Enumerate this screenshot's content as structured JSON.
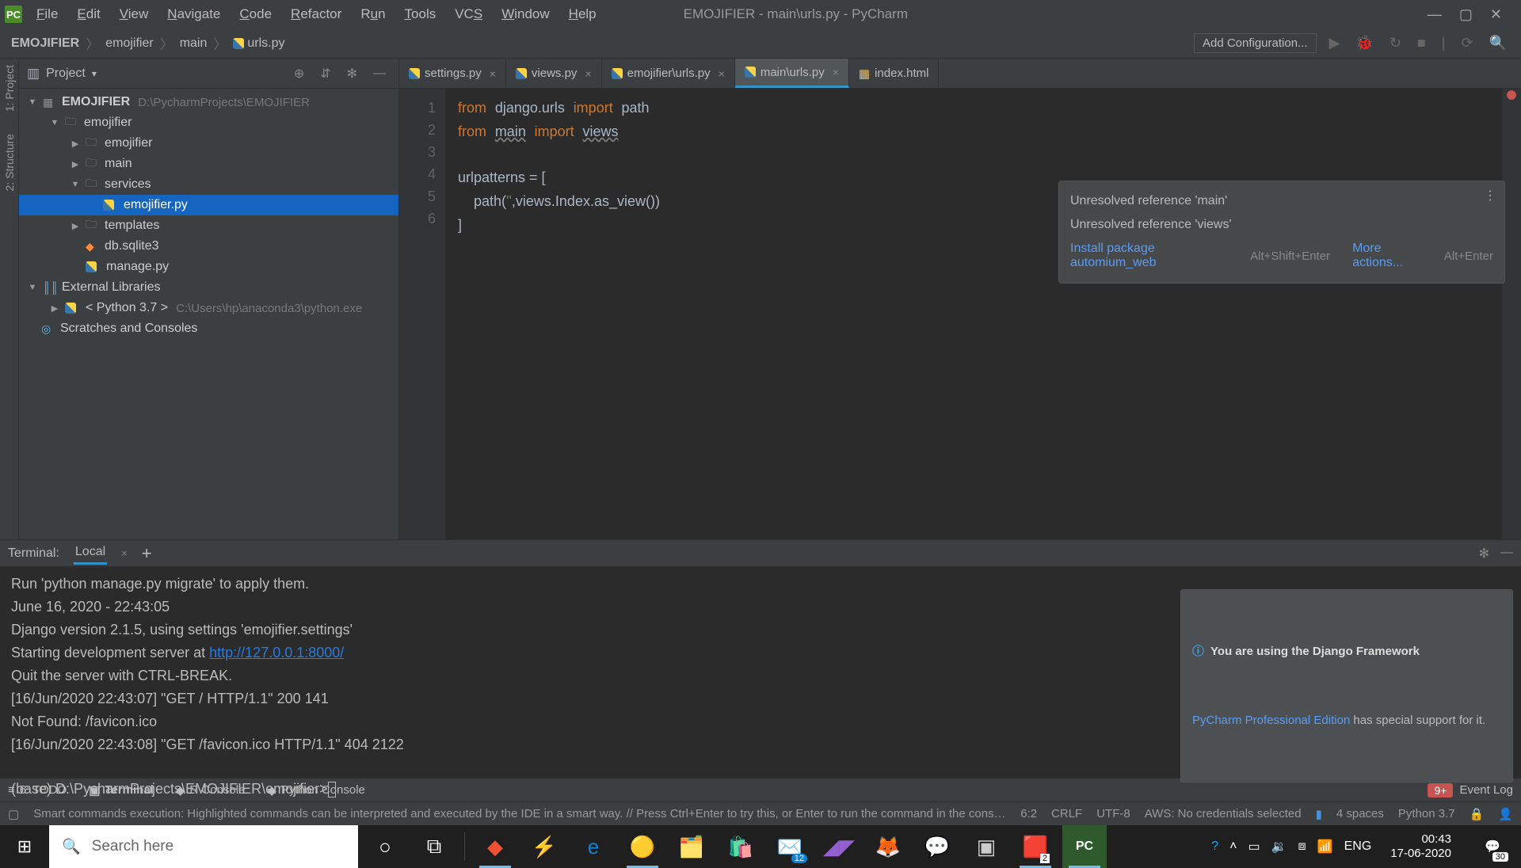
{
  "menubar": [
    "File",
    "Edit",
    "View",
    "Navigate",
    "Code",
    "Refactor",
    "Run",
    "Tools",
    "VCS",
    "Window",
    "Help"
  ],
  "window_title": "EMOJIFIER - main\\urls.py - PyCharm",
  "breadcrumb": [
    "EMOJIFIER",
    "emojifier",
    "main",
    "urls.py"
  ],
  "add_config": "Add Configuration...",
  "left_tools": [
    "1: Project",
    "2: Structure"
  ],
  "project_label": "Project",
  "tree": {
    "root": "EMOJIFIER",
    "root_path": "D:\\PycharmProjects\\EMOJIFIER",
    "emojifier": "emojifier",
    "emojifier2": "emojifier",
    "main": "main",
    "services": "services",
    "emojifierpy": "emojifier.py",
    "templates": "templates",
    "db": "db.sqlite3",
    "manage": "manage.py",
    "extlib": "External Libraries",
    "python37": "< Python 3.7 >",
    "python37_path": "C:\\Users\\hp\\anaconda3\\python.exe",
    "scratches": "Scratches and Consoles"
  },
  "tabs": [
    {
      "label": "settings.py",
      "active": false
    },
    {
      "label": "views.py",
      "active": false
    },
    {
      "label": "emojifier\\urls.py",
      "active": false
    },
    {
      "label": "main\\urls.py",
      "active": true
    },
    {
      "label": "index.html",
      "active": false
    }
  ],
  "code_lines": [
    "1",
    "2",
    "3",
    "4",
    "5",
    "6"
  ],
  "code": {
    "l1a": "from",
    "l1b": "django.urls",
    "l1c": "import",
    "l1d": "path",
    "l2a": "from",
    "l2b": "main",
    "l2c": "import",
    "l2d": "views",
    "l4": "urlpatterns = [",
    "l5a": "    path(",
    "l5b": "''",
    "l5c": ",views.Index.as_view())",
    "l6": "]"
  },
  "hint": {
    "r1": "Unresolved reference 'main'",
    "r2": "Unresolved reference 'views'",
    "link1": "Install package automium_web",
    "s1": "Alt+Shift+Enter",
    "link2": "More actions...",
    "s2": "Alt+Enter"
  },
  "terminal": {
    "label": "Terminal:",
    "tab": "Local",
    "line1": "Run 'python manage.py migrate' to apply them.",
    "line2": "June 16, 2020 - 22:43:05",
    "line3": "Django version 2.1.5, using settings 'emojifier.settings'",
    "line4a": "Starting development server at ",
    "line4b": "http://127.0.0.1:8000/",
    "line5": "Quit the server with CTRL-BREAK.",
    "line6": "[16/Jun/2020 22:43:07] \"GET / HTTP/1.1\" 200 141",
    "line7": "Not Found: /favicon.ico",
    "line8": "[16/Jun/2020 22:43:08] \"GET /favicon.ico HTTP/1.1\" 404 2122",
    "prompt": "(base) D:\\PycharmProjects\\EMOJIFIER\\emojifier>"
  },
  "django_toast": {
    "title": "You are using the Django Framework",
    "link": "PyCharm Professional Edition",
    "text": " has special support for it."
  },
  "bottom_tabs": {
    "todo": "6: TODO",
    "terminal": "Terminal",
    "rconsole": "R Console",
    "python": "Python Console",
    "event": "Event Log"
  },
  "statusbar": {
    "msg": "Smart commands execution: Highlighted commands can be interpreted and executed by the IDE in a smart way. // Press Ctrl+Enter to try this, or Enter to run the command in the cons... (yesterday .",
    "pos": "6:2",
    "lf": "CRLF",
    "enc": "UTF-8",
    "aws": "AWS: No credentials selected",
    "spaces": "4 spaces",
    "py": "Python 3.7"
  },
  "taskbar": {
    "search": "Search here",
    "time": "00:43",
    "date": "17-06-2020",
    "lang": "ENG",
    "notif": "30",
    "mail_badge": "12",
    "scr_badge": "2"
  }
}
